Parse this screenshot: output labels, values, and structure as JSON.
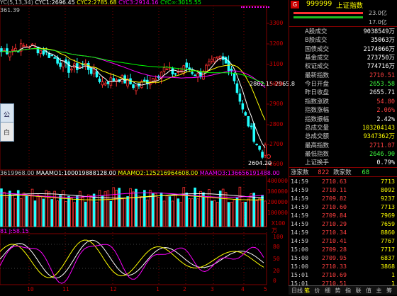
{
  "indicator_bar": {
    "cyc_label": "YC(5,13,34)",
    "cyc1": "CYC1:2696.45",
    "cyc2": "CYC2:2785.68",
    "cyc3": "CYC3:2914.16",
    "cyc_inf": "CYC∞:3015.55"
  },
  "price_chart": {
    "top_left_value": "361.39",
    "range_label": "2862.15-2965.8",
    "low_label": "2604.20",
    "y_ticks": [
      "3300",
      "3200",
      "3100",
      "3000",
      "2900",
      "2800",
      "2700",
      "2600"
    ]
  },
  "volume_chart": {
    "header_value": "3619968.00",
    "maamo1": "MAAMO1:100019888128.00",
    "maamo2": "MAAMO2:125216964608.00",
    "maamo3": "MAAMO3:136656191488.00",
    "y_ticks": [
      "400000",
      "300000",
      "200000",
      "100000"
    ],
    "unit": "X100万"
  },
  "kdj_chart": {
    "header": "81 J:58.15",
    "y_ticks": [
      "100",
      "80",
      "50",
      "20",
      "0"
    ]
  },
  "date_axis": [
    "10",
    "11",
    "12",
    "1",
    "2",
    "3",
    "4",
    "5"
  ],
  "popup_window": {
    "text1": "公",
    "text2": "白"
  },
  "quote": {
    "code_badge": "G",
    "code": "999999",
    "name": "上证指数",
    "mini_value": "23.0亿",
    "mini_value2": "17.0亿",
    "stats": [
      {
        "label": "A股成交",
        "value": "9038549万",
        "color": "#ffffff"
      },
      {
        "label": "B股成交",
        "value": "35063万",
        "color": "#ffffff"
      },
      {
        "label": "国债成交",
        "value": "2174066万",
        "color": "#ffffff"
      },
      {
        "label": "基金成交",
        "value": "273750万",
        "color": "#ffffff"
      },
      {
        "label": "权证成交",
        "value": "774716万",
        "color": "#ffffff"
      },
      {
        "label": "最新指数",
        "value": "2710.51",
        "color": "#ff4040"
      },
      {
        "label": "今日开盘",
        "value": "2653.58",
        "color": "#40ff40"
      },
      {
        "label": "昨日收盘",
        "value": "2655.71",
        "color": "#ffffff"
      },
      {
        "label": "指数涨跌",
        "value": "54.80",
        "color": "#ff4040"
      },
      {
        "label": "指数涨幅",
        "value": "2.06%",
        "color": "#ff4040"
      },
      {
        "label": "指数振幅",
        "value": "2.42%",
        "color": "#ffffff"
      },
      {
        "label": "总成交量",
        "value": "103204143",
        "color": "#ffff00"
      },
      {
        "label": "总成交额",
        "value": "9347362万",
        "color": "#ffff00"
      },
      {
        "label": "最高指数",
        "value": "2711.07",
        "color": "#ff4040"
      },
      {
        "label": "最低指数",
        "value": "2646.90",
        "color": "#40ff40"
      },
      {
        "label": "上证换手",
        "value": "0.79%",
        "color": "#ffffff"
      }
    ],
    "updown": {
      "up_label": "涨家数",
      "up": "822",
      "down_label": "跌家数",
      "down": "68"
    },
    "ticks": [
      {
        "time": "14:59",
        "price": "2710.63",
        "vol": "7713"
      },
      {
        "time": "14:59",
        "price": "2710.11",
        "vol": "8092"
      },
      {
        "time": "14:59",
        "price": "2709.82",
        "vol": "9237"
      },
      {
        "time": "14:59",
        "price": "2710.60",
        "vol": "7713"
      },
      {
        "time": "14:59",
        "price": "2709.84",
        "vol": "7969"
      },
      {
        "time": "14:59",
        "price": "2710.29",
        "vol": "7659"
      },
      {
        "time": "14:59",
        "price": "2710.34",
        "vol": "8860"
      },
      {
        "time": "14:59",
        "price": "2710.41",
        "vol": "7767"
      },
      {
        "time": "15:00",
        "price": "2709.28",
        "vol": "7717"
      },
      {
        "time": "15:00",
        "price": "2709.95",
        "vol": "6837"
      },
      {
        "time": "15:00",
        "price": "2710.33",
        "vol": "3868"
      },
      {
        "time": "15:01",
        "price": "2710.69",
        "vol": "1"
      },
      {
        "time": "15:01",
        "price": "2710.51",
        "vol": "1"
      }
    ],
    "tabs": [
      "日线",
      "笔",
      "价",
      "细",
      "势",
      "指",
      "联",
      "值",
      "主",
      "筹"
    ]
  },
  "colors": {
    "up": "#ff3030",
    "down": "#20ffff",
    "grid": "#800000",
    "cyc1": "#ffffff",
    "cyc2": "#ffff00",
    "cyc3": "#ff00ff",
    "cycinf": "#00ff00"
  }
}
